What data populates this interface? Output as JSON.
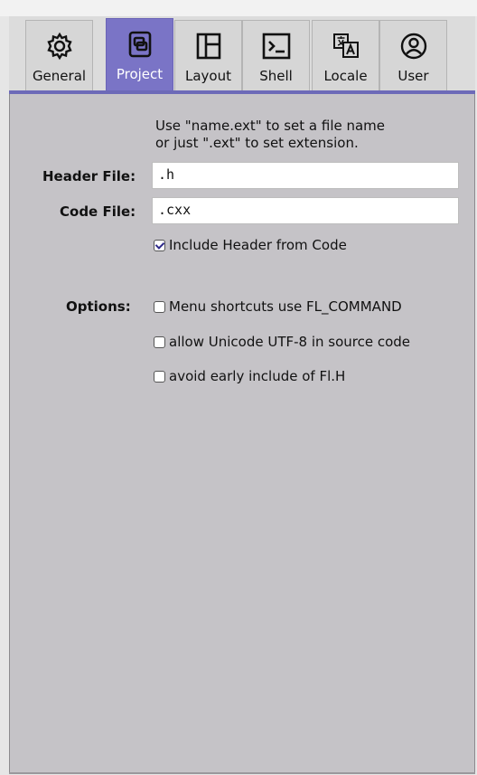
{
  "tabs": [
    {
      "label": "General",
      "icon": "gear-icon",
      "active": false
    },
    {
      "label": "Project",
      "icon": "project-icon",
      "active": true
    },
    {
      "label": "Layout",
      "icon": "layout-icon",
      "active": false
    },
    {
      "label": "Shell",
      "icon": "terminal-icon",
      "active": false
    },
    {
      "label": "Locale",
      "icon": "translate-icon",
      "active": false
    },
    {
      "label": "User",
      "icon": "user-icon",
      "active": false
    }
  ],
  "project": {
    "hint_line1": "Use \"name.ext\" to set a file name",
    "hint_line2": "or just \".ext\" to set extension.",
    "header_file_label": "Header File:",
    "header_file_value": ".h",
    "code_file_label": "Code File:",
    "code_file_value": ".cxx",
    "include_header_label": "Include Header from Code",
    "include_header_checked": true,
    "options_label": "Options:",
    "options": [
      {
        "label": "Menu shortcuts use FL_COMMAND",
        "checked": false
      },
      {
        "label": "allow Unicode UTF-8 in source code",
        "checked": false
      },
      {
        "label": "avoid early include of Fl.H",
        "checked": false
      }
    ]
  },
  "colors": {
    "active_tab": "#7a74c6",
    "panel": "#c5c3c7",
    "check_mark": "#2e2a8a"
  }
}
